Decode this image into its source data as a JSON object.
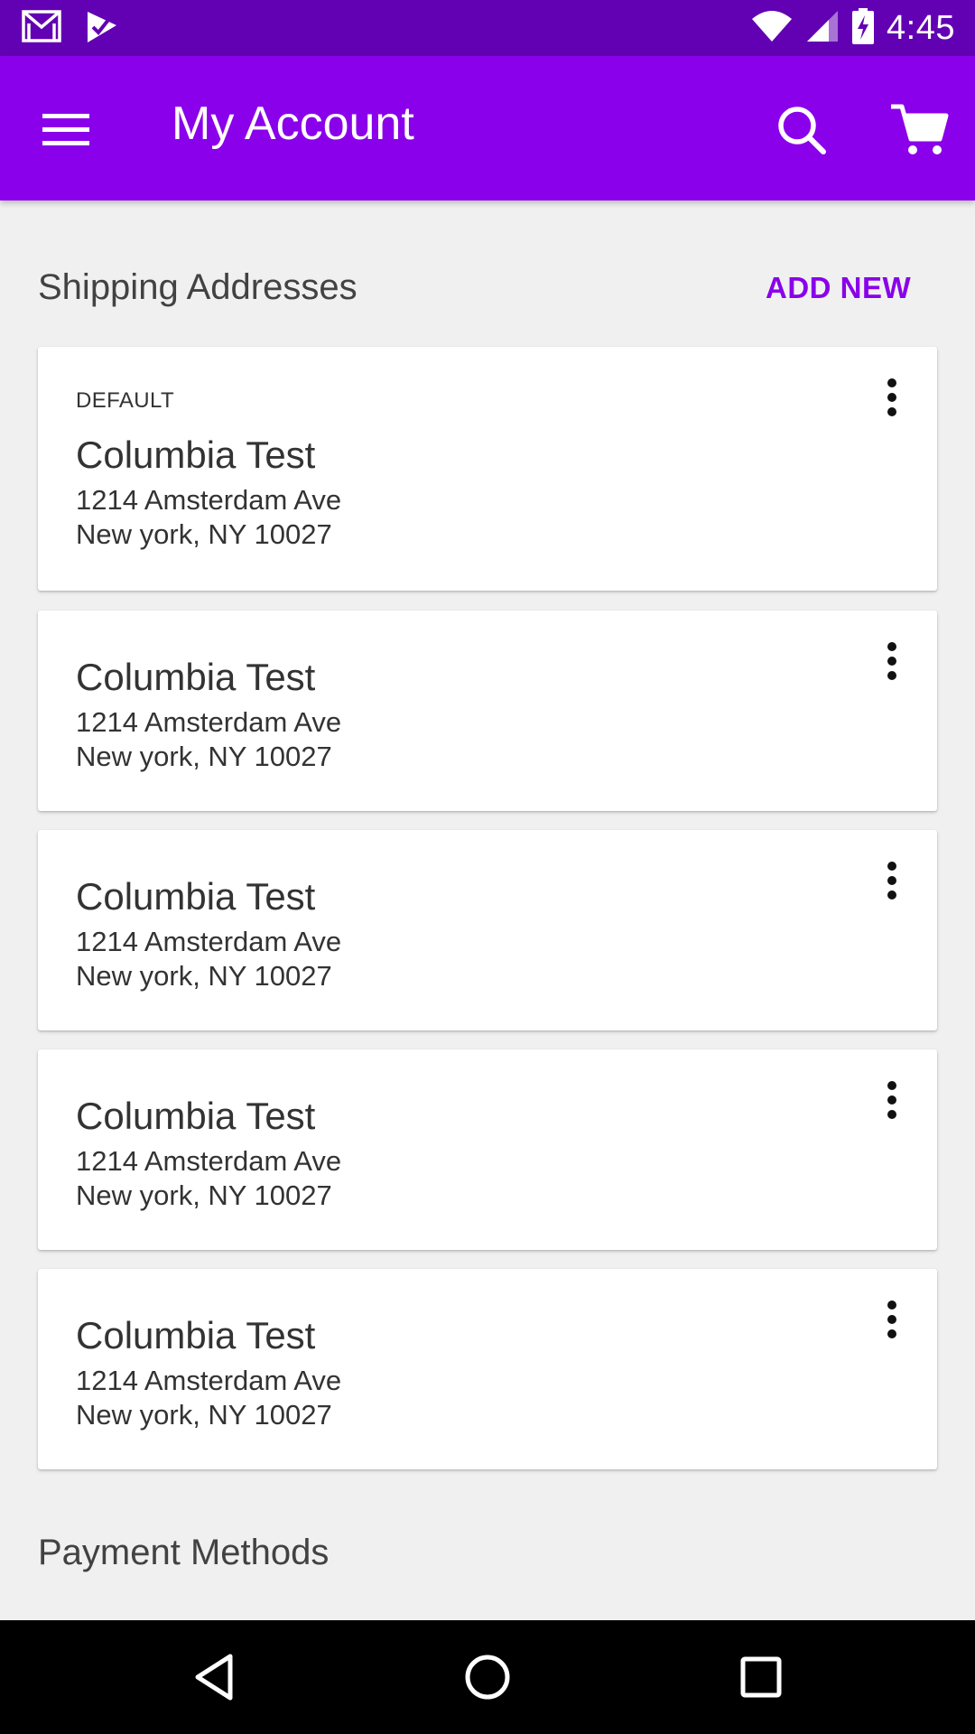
{
  "status_bar": {
    "time": "4:45",
    "icons": [
      "gmail-icon",
      "checklist-icon",
      "wifi-icon",
      "cell-signal-icon",
      "battery-charging-icon"
    ]
  },
  "app_bar": {
    "title": "My Account",
    "icons": [
      "menu-icon",
      "search-icon",
      "cart-icon"
    ]
  },
  "shipping": {
    "header": "Shipping Addresses",
    "add_new_label": "ADD NEW",
    "addresses": [
      {
        "badge": "DEFAULT",
        "name": "Columbia Test",
        "line1": "1214 Amsterdam Ave",
        "line2": "New york, NY 10027"
      },
      {
        "name": "Columbia Test",
        "line1": "1214 Amsterdam Ave",
        "line2": "New york, NY 10027"
      },
      {
        "name": "Columbia Test",
        "line1": "1214 Amsterdam Ave",
        "line2": "New york, NY 10027"
      },
      {
        "name": "Columbia Test",
        "line1": "1214 Amsterdam Ave",
        "line2": "New york, NY 10027"
      },
      {
        "name": "Columbia Test",
        "line1": "1214 Amsterdam Ave",
        "line2": "New york, NY 10027"
      }
    ]
  },
  "payment": {
    "header": "Payment Methods"
  },
  "nav_bar": {
    "icons": [
      "back-icon",
      "home-icon",
      "recents-icon"
    ]
  },
  "colors": {
    "status_bar": "#6200b3",
    "app_bar": "#8a00ea",
    "accent": "#8a00ea",
    "background": "#f0f0f0",
    "card": "#ffffff",
    "nav_bar": "#000000"
  }
}
